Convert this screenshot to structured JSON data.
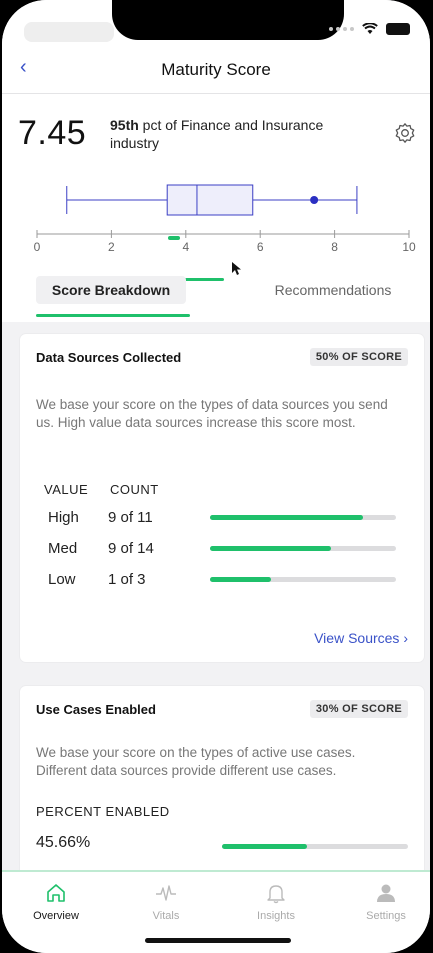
{
  "nav": {
    "back_icon": "chevron-left-icon",
    "title": "Maturity Score"
  },
  "score": {
    "value": "7.45",
    "percentile": "95th",
    "percentile_rest": " pct of Finance and Insurance industry"
  },
  "boxplot": {
    "axis_ticks": [
      "0",
      "2",
      "4",
      "6",
      "8",
      "10"
    ],
    "axis_range": [
      0,
      10
    ],
    "whisker_low": 0.8,
    "q1": 3.5,
    "median": 4.3,
    "q3": 5.8,
    "whisker_high": 8.6,
    "score_marker": 7.45,
    "accent": "#3b3fc4"
  },
  "tabs": {
    "active": "Score Breakdown",
    "inactive": "Recommendations"
  },
  "data_sources": {
    "title": "Data Sources Collected",
    "badge": "50% OF SCORE",
    "description": "We base your score on the types of data sources you send us. High value data sources increase this score most.",
    "col_value": "VALUE",
    "col_count": "COUNT",
    "rows": [
      {
        "label": "High",
        "count": "9 of 11",
        "fill": 0.82
      },
      {
        "label": "Med",
        "count": "9 of 14",
        "fill": 0.65
      },
      {
        "label": "Low",
        "count": "1 of 3",
        "fill": 0.33
      }
    ],
    "link": "View Sources ›"
  },
  "use_cases": {
    "title": "Use Cases Enabled",
    "badge": "30% OF SCORE",
    "description": "We base your score on the types of active use cases. Different data sources provide different use cases.",
    "label": "PERCENT ENABLED",
    "value": "45.66%",
    "fill": 0.4566
  },
  "tabbar": [
    {
      "label": "Overview",
      "icon": "home-icon",
      "active": true
    },
    {
      "label": "Vitals",
      "icon": "pulse-icon",
      "active": false
    },
    {
      "label": "Insights",
      "icon": "bell-icon",
      "active": false
    },
    {
      "label": "Settings",
      "icon": "person-icon",
      "active": false
    }
  ],
  "colors": {
    "green": "#1fc06b",
    "link": "#3a52c8"
  }
}
